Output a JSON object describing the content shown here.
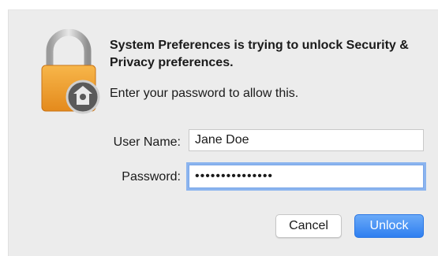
{
  "dialog": {
    "title": "System Preferences is trying to unlock Security & Privacy preferences.",
    "subtitle": "Enter your password to allow this.",
    "icon": "lock-icon"
  },
  "form": {
    "username_label": "User Name:",
    "username_value": "Jane Doe",
    "password_label": "Password:",
    "password_value": "•••••••••••••••"
  },
  "buttons": {
    "cancel_label": "Cancel",
    "unlock_label": "Unlock"
  },
  "colors": {
    "accent": "#2f7ff0",
    "lock_body": "#f2a12e",
    "focus_ring": "#8bb4ef"
  }
}
